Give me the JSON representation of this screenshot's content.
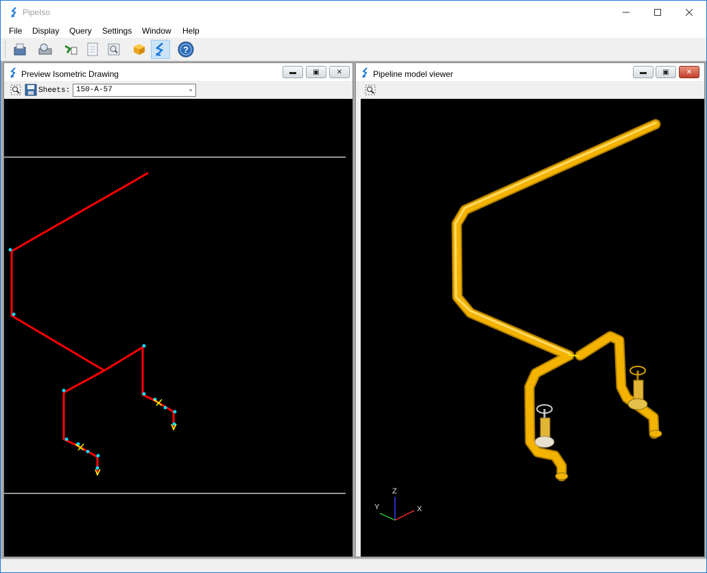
{
  "window": {
    "title": "PipeIso"
  },
  "menu": {
    "items": [
      "File",
      "Display",
      "Query",
      "Settings",
      "Window",
      "Help"
    ]
  },
  "toolbar": {
    "buttons": [
      {
        "name": "open-icon"
      },
      {
        "name": "print-preview-icon"
      },
      {
        "name": "connect-icon"
      },
      {
        "name": "document-icon"
      },
      {
        "name": "zoom-icon"
      },
      {
        "name": "box-3d-icon"
      },
      {
        "name": "pipeiso-logo-icon"
      },
      {
        "name": "help-icon"
      }
    ]
  },
  "iso_window": {
    "title": "Preview Isometric Drawing",
    "sheets_label": "Sheets:",
    "sheet_selected": "150-A-57"
  },
  "model_window": {
    "title": "Pipeline model viewer",
    "axes": {
      "x": "X",
      "y": "Y",
      "z": "Z"
    }
  },
  "colors": {
    "iso_pipe": "#ff0000",
    "iso_node": "#00e0ff",
    "model_pipe": "#f3b300",
    "background": "#000000"
  }
}
